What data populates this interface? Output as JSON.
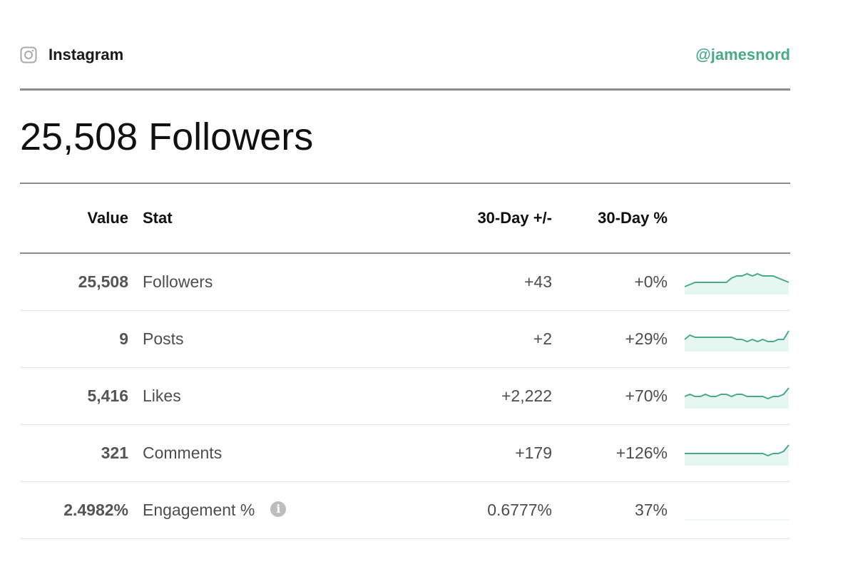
{
  "header": {
    "platform_icon": "instagram-icon",
    "platform_name": "Instagram",
    "handle": "@jamesnord"
  },
  "headline": "25,508 Followers",
  "table": {
    "columns": [
      "Value",
      "Stat",
      "30-Day +/-",
      "30-Day %"
    ],
    "rows": [
      {
        "value": "25,508",
        "stat": "Followers",
        "diff": "+43",
        "pct": "+0%",
        "trend": [
          3,
          4,
          5,
          5,
          5,
          5,
          5,
          5,
          5,
          7,
          8,
          8,
          9,
          8,
          9,
          8,
          8,
          8,
          7,
          6,
          5
        ]
      },
      {
        "value": "9",
        "stat": "Posts",
        "diff": "+2",
        "pct": "+29%",
        "trend": [
          5,
          7,
          6,
          6,
          6,
          6,
          6,
          6,
          6,
          6,
          5,
          5,
          4,
          5,
          4,
          5,
          4,
          4,
          5,
          5,
          9
        ]
      },
      {
        "value": "5,416",
        "stat": "Likes",
        "diff": "+2,222",
        "pct": "+70%",
        "trend": [
          5,
          6,
          5,
          5,
          6,
          5,
          5,
          6,
          6,
          5,
          6,
          6,
          5,
          5,
          5,
          5,
          4,
          5,
          5,
          6,
          9
        ]
      },
      {
        "value": "321",
        "stat": "Comments",
        "diff": "+179",
        "pct": "+126%",
        "trend": [
          5,
          5,
          5,
          5,
          5,
          5,
          5,
          5,
          5,
          5,
          5,
          5,
          5,
          5,
          5,
          5,
          4,
          5,
          5,
          6,
          9
        ]
      },
      {
        "value": "2.4982%",
        "stat": "Engagement %",
        "diff": "0.6777%",
        "pct": "37%",
        "trend": [],
        "info": "i"
      }
    ]
  },
  "colors": {
    "accent": "#4aa98a",
    "spark_fill": "#e6f6f0",
    "rule": "#8c8c8c"
  }
}
